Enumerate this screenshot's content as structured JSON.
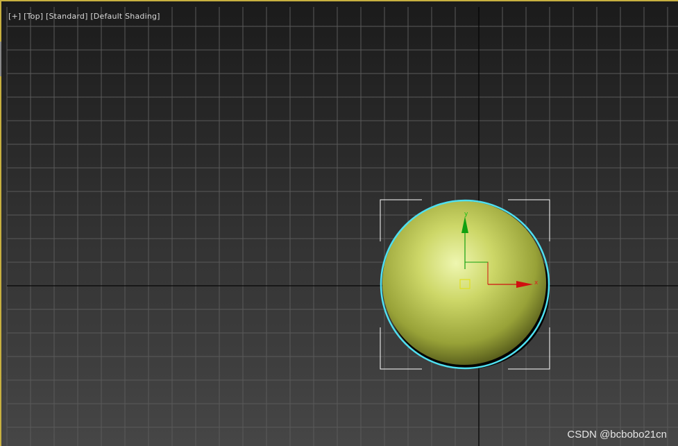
{
  "viewport": {
    "menu_plus": "[+]",
    "view_name": "[Top]",
    "render_mode": "[Standard]",
    "shading_mode": "[Default Shading]"
  },
  "gizmo": {
    "x_axis_label": "x",
    "y_axis_label": "y"
  },
  "colors": {
    "viewport_border": "#c8b040",
    "sphere_fill": "#c9d35a",
    "selection_outline": "#4fe0f0",
    "x_axis": "#d01010",
    "y_axis": "#10a010",
    "pivot": "#e0e020"
  },
  "watermark": "CSDN @bcbobo21cn"
}
